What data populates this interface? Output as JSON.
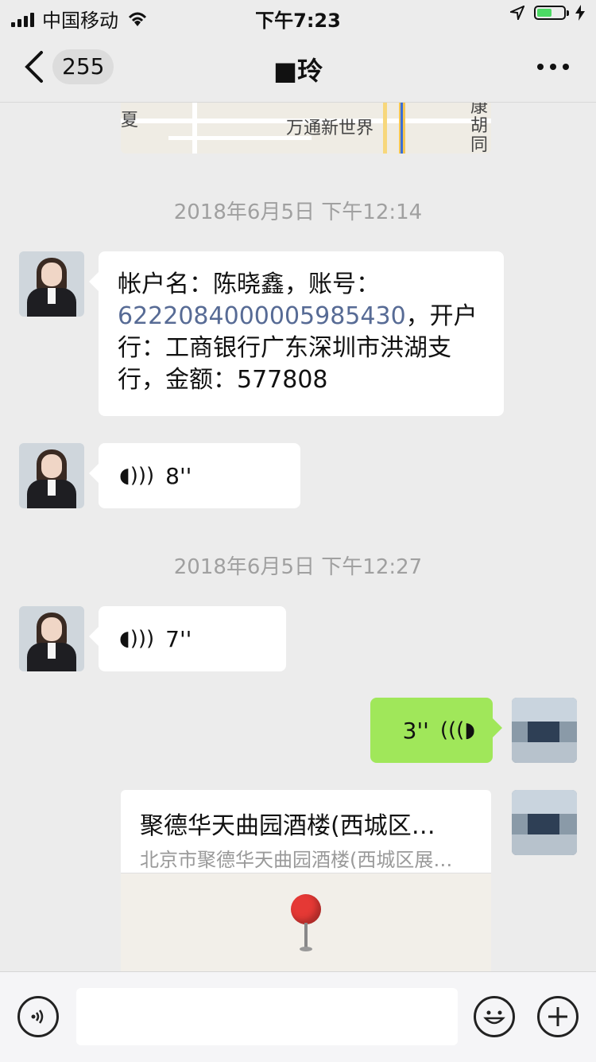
{
  "status_bar": {
    "carrier": "中国移动",
    "time": "下午7:23"
  },
  "nav": {
    "unread_count": "255",
    "title": "■玲"
  },
  "map_top": {
    "place_label": "万通新世界",
    "side_text_left": "夏",
    "side_text_right": "康胡同"
  },
  "messages": {
    "ts1": "2018年6月5日 下午12:14",
    "text_prefix": "帐户名：陈晓鑫，账号：",
    "account_number": "6222084000005985430",
    "text_suffix": "，开户行：工商银行广东深圳市洪湖支行，金额：577808",
    "voice1": "8''",
    "ts2": "2018年6月5日 下午12:27",
    "voice2": "7''",
    "voice3": "3''"
  },
  "location": {
    "name": "聚德华天曲园酒楼(西城区…",
    "address": "北京市聚德华天曲园酒楼(西城区展…"
  },
  "icons": {
    "voice": "voice-icon",
    "emoji": "emoji-icon",
    "plus": "plus-icon"
  },
  "colors": {
    "my_bubble": "#a0e75a",
    "link": "#576b95"
  }
}
